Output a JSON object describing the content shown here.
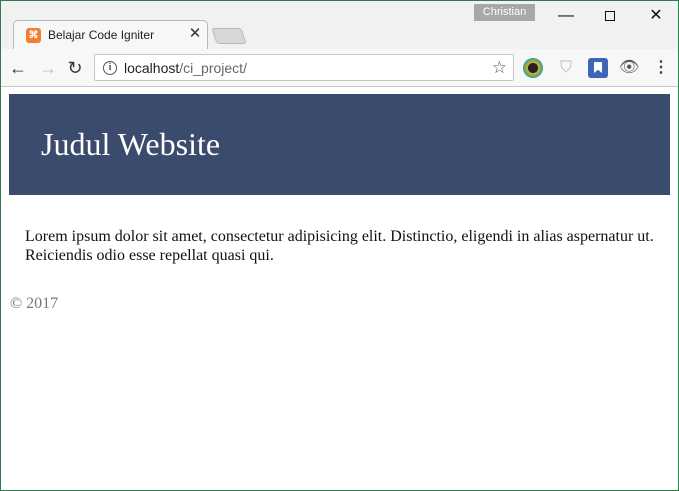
{
  "browser": {
    "tab_title": "Belajar Code Igniter",
    "tab_close": "✕",
    "profile_name": "Christian",
    "url_host": "localhost",
    "url_path": "/ci_project/",
    "icons": {
      "back": "←",
      "forward": "→",
      "reload": "↻",
      "info": "i",
      "star": "☆",
      "shield": "⛉",
      "eye": "👁",
      "menu": "⋮",
      "minimize": "—",
      "close": "✕"
    },
    "colors": {
      "favicon": "#f27e2f",
      "bookmark_ext": "#3c67b5",
      "window_border": "#2e7d4f"
    }
  },
  "page": {
    "header_title": "Judul Website",
    "header_bg": "#3b4b6e",
    "body_text": "Lorem ipsum dolor sit amet, consectetur adipisicing elit. Distinctio, eligendi in alias aspernatur ut. Reiciendis odio esse repellat quasi qui.",
    "footer_text": "© 2017"
  }
}
